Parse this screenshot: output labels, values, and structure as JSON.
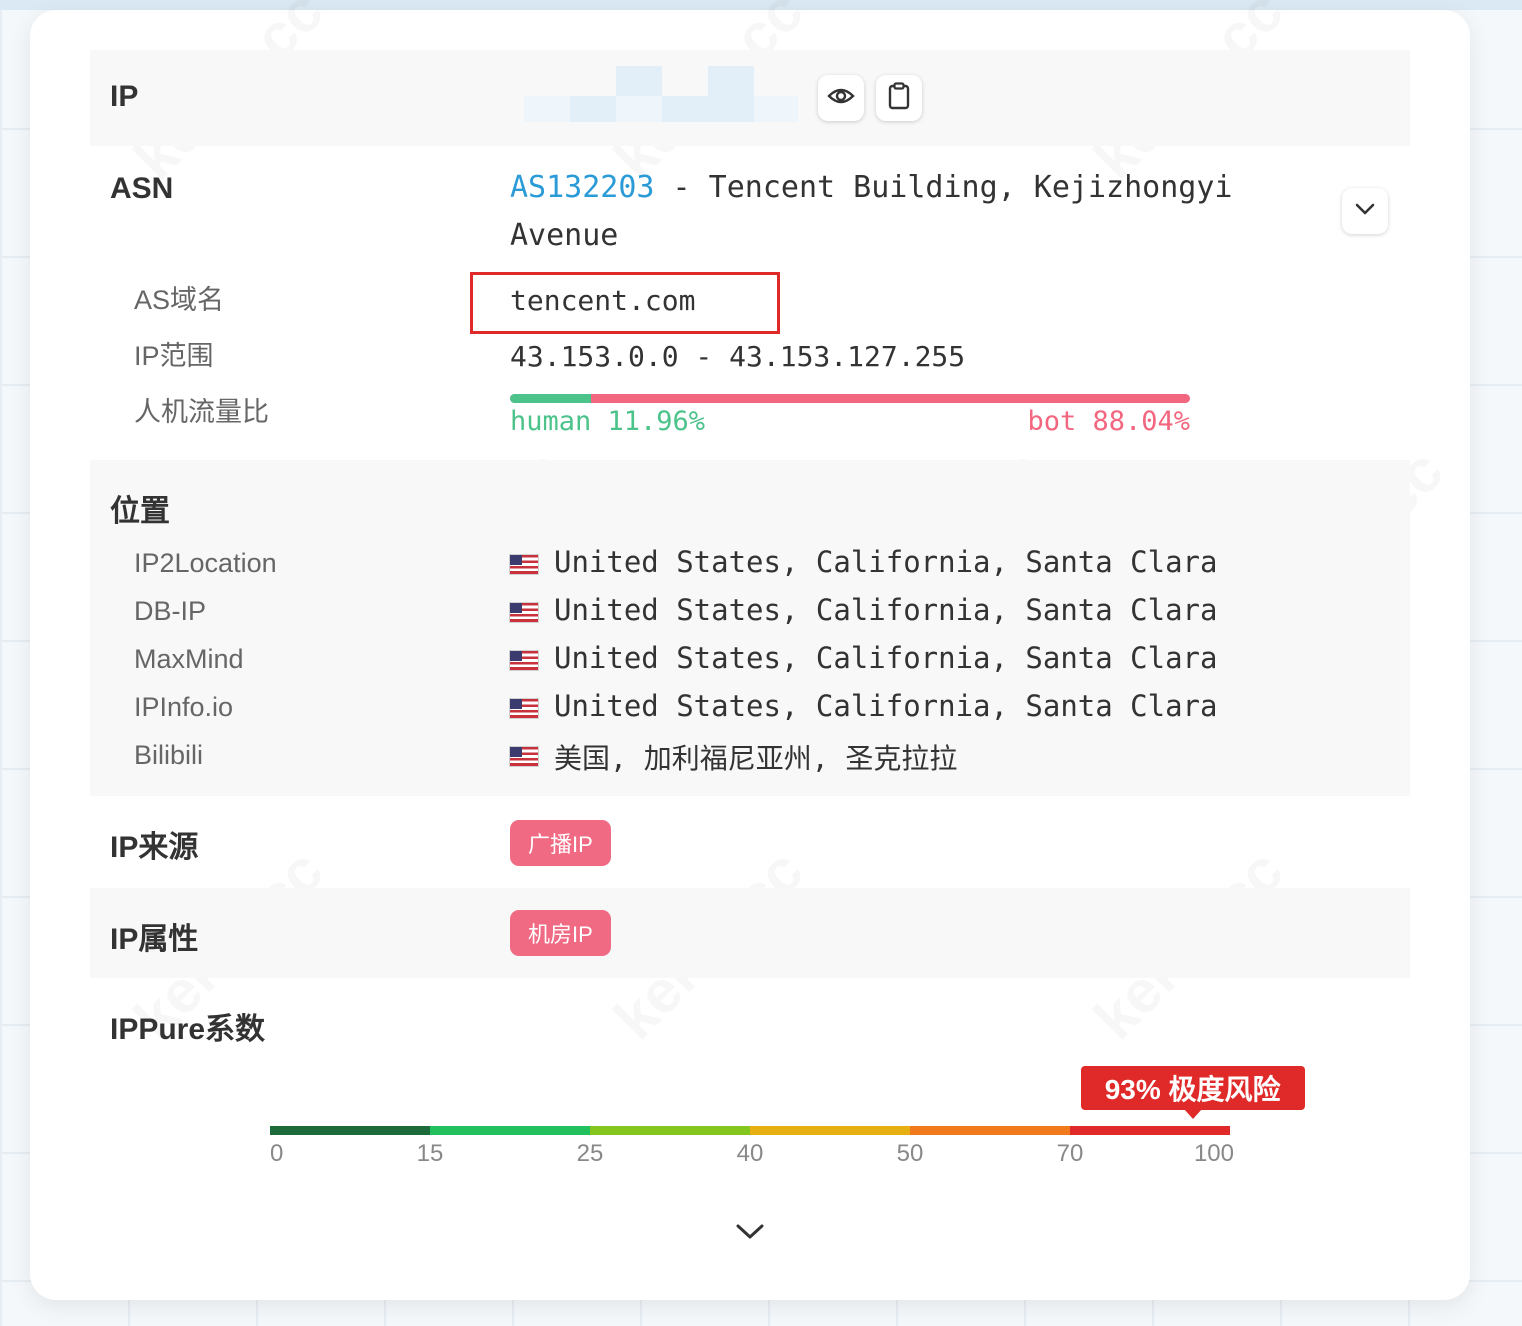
{
  "ip": {
    "label": "IP",
    "show_icon": "eye-icon",
    "copy_icon": "clipboard-icon"
  },
  "asn": {
    "label": "ASN",
    "number": "AS132203",
    "name_line1": " - Tencent Building, Kejizhongyi",
    "name_line2": "Avenue",
    "expand_icon": "chevron-down-icon",
    "link_color": "#2b9bd8",
    "domain_label": "AS域名",
    "domain_value": "tencent.com",
    "range_label": "IP范围",
    "range_value": "43.153.0.0 - 43.153.127.255",
    "traffic_label": "人机流量比",
    "human_text": "human 11.96%",
    "bot_text": "bot 88.04%",
    "human_ratio": 0.1196,
    "human_color": "#4cc38a",
    "bot_color": "#f2667f"
  },
  "location": {
    "label": "位置",
    "rows": [
      {
        "source": "IP2Location",
        "value": "United States, California, Santa Clara"
      },
      {
        "source": "DB-IP",
        "value": "United States, California, Santa Clara"
      },
      {
        "source": "MaxMind",
        "value": "United States, California, Santa Clara"
      },
      {
        "source": "IPInfo.io",
        "value": "United States, California, Santa Clara"
      },
      {
        "source": "Bilibili",
        "value": "美国, 加利福尼亚州, 圣克拉拉"
      }
    ]
  },
  "source": {
    "label": "IP来源",
    "tag": "广播IP"
  },
  "attribute": {
    "label": "IP属性",
    "tag": "机房IP"
  },
  "ippure": {
    "label": "IPPure系数",
    "score": 93,
    "badge": "93% 极度风险",
    "badge_color": "#e02a2a",
    "ticks": [
      "0",
      "15",
      "25",
      "40",
      "50",
      "70",
      "100"
    ],
    "segment_colors": [
      "#1d6b3b",
      "#22c15e",
      "#84c61e",
      "#e6b012",
      "#f07a1c",
      "#e02a2a"
    ]
  },
  "footer": {
    "expand_icon": "chevron-down-icon"
  },
  "watermark": "kelen.cc"
}
